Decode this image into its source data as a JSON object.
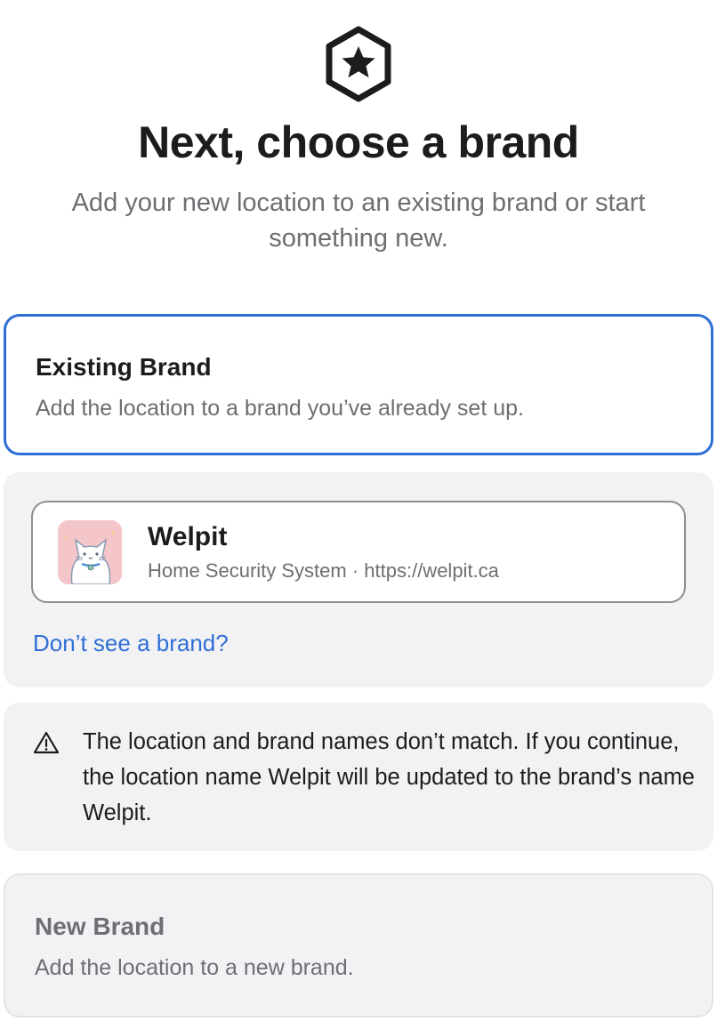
{
  "header": {
    "icon": "star-hexagon-icon",
    "title": "Next, choose a brand",
    "subtitle": "Add your new location to an existing brand or start something new."
  },
  "existing_brand": {
    "title": "Existing Brand",
    "description": "Add the location to a brand you’ve already set up.",
    "selected": true
  },
  "brands": [
    {
      "name": "Welpit",
      "meta": "Home Security System · https://welpit.ca",
      "avatar": "cat-avatar"
    }
  ],
  "dont_see_link": "Don’t see a brand?",
  "warning": {
    "icon": "warning-triangle-icon",
    "text": "The location and brand names don’t match. If you continue, the location name Welpit will be updated to the brand’s name Welpit."
  },
  "new_brand": {
    "title": "New Brand",
    "description": "Add the location to a new brand.",
    "selected": false
  },
  "colors": {
    "accent": "#2f6fd6",
    "panel_bg": "#f2f2f5",
    "muted_text": "#6e6e73",
    "primary_text": "#1c1c1e"
  }
}
